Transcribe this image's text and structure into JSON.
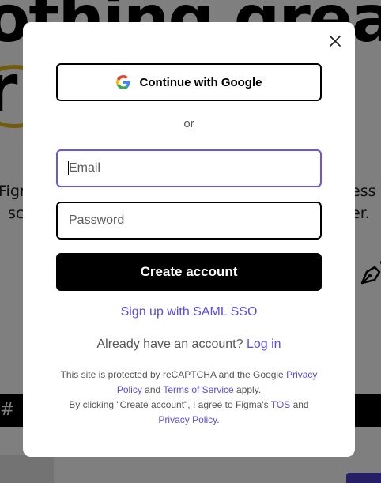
{
  "background": {
    "headline_line1": "othing great",
    "headline_line2": "r          e.",
    "sub_line1_left": "Figm",
    "sub_line2_left": "sc",
    "sub_line1_right": "ess",
    "sub_line2_right": "er.",
    "bar_icon": "#"
  },
  "modal": {
    "close_icon": "close-icon",
    "google_button_label": "Continue with Google",
    "google_icon": "google-logo-icon",
    "or_text": "or",
    "email_placeholder": "Email",
    "password_placeholder": "Password",
    "create_account_label": "Create account",
    "saml_link": "Sign up with SAML SSO",
    "login_prompt": "Already have an account?",
    "login_link": "Log in",
    "legal": {
      "recaptcha_text": "This site is protected by reCAPTCHA and the Google",
      "privacy_policy_link": "Privacy Policy",
      "and_text": "and",
      "terms_link": "Terms of Service",
      "apply_text": "apply.",
      "agree_text": "By clicking \"Create account\", I agree to Figma's",
      "tos_link": "TOS",
      "and_text_2": "and",
      "privacy_policy_link_2": "Privacy Policy",
      "period": "."
    }
  },
  "colors": {
    "accent_link": "#5a4fe0",
    "focus_border": "#6657e6",
    "primary_button": "#000000",
    "overlay": "rgba(0,0,0,0.5)"
  }
}
